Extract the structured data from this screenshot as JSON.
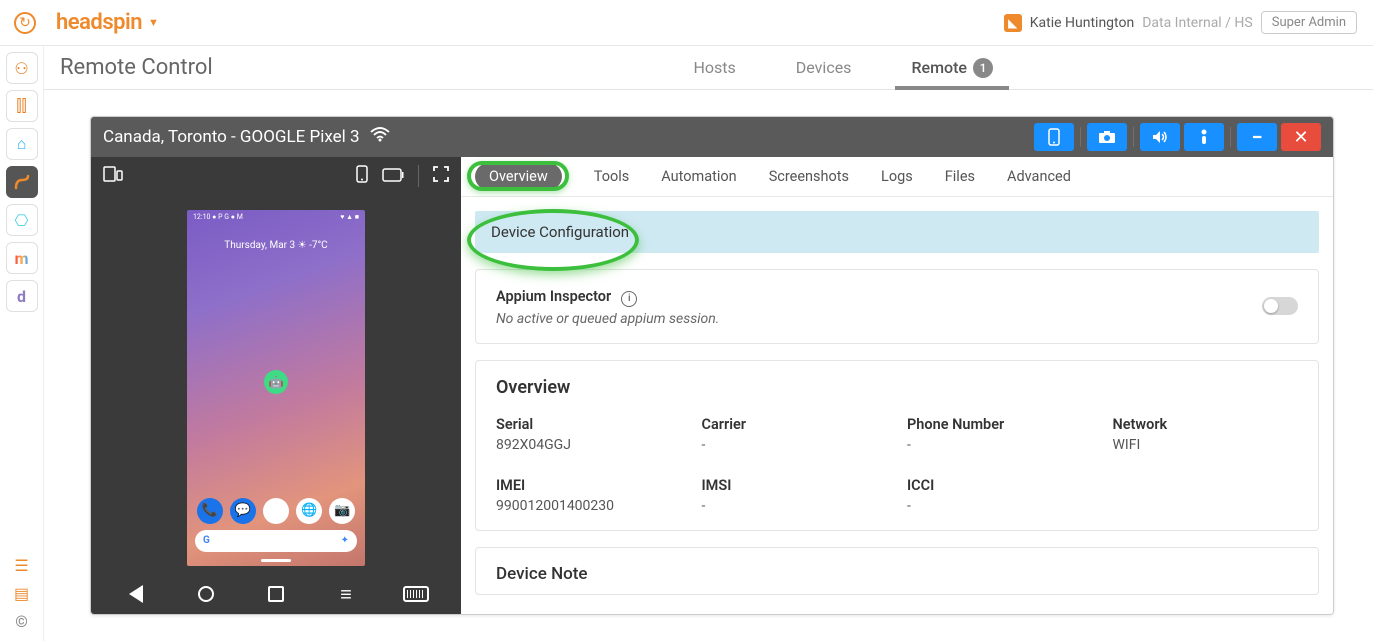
{
  "brand": "headspin",
  "user": {
    "name": "Katie Huntington",
    "org": "Data Internal / HS",
    "role": "Super Admin"
  },
  "page_title": "Remote Control",
  "subtabs": {
    "hosts": "Hosts",
    "devices": "Devices",
    "remote": "Remote",
    "remote_badge": "1"
  },
  "rail_icons": [
    "org",
    "chart",
    "home",
    "route",
    "search",
    "m",
    "d"
  ],
  "device_window": {
    "title": "Canada, Toronto - GOOGLE Pixel 3"
  },
  "phone": {
    "status_left": "12:10 ● P G ● M",
    "status_right": "♥ ▲ ■",
    "date_line": "Thursday, Mar 3 ☀ -7°C",
    "search_letter": "G"
  },
  "tabs": {
    "overview": "Overview",
    "tools": "Tools",
    "automation": "Automation",
    "screenshots": "Screenshots",
    "logs": "Logs",
    "files": "Files",
    "advanced": "Advanced"
  },
  "device_config_label": "Device Configuration",
  "appium": {
    "title": "Appium Inspector",
    "sub": "No active or queued appium session."
  },
  "overview_section": {
    "heading": "Overview",
    "fields": {
      "serial": {
        "label": "Serial",
        "value": "892X04GGJ"
      },
      "carrier": {
        "label": "Carrier",
        "value": "-"
      },
      "phone": {
        "label": "Phone Number",
        "value": "-"
      },
      "network": {
        "label": "Network",
        "value": "WIFI"
      },
      "imei": {
        "label": "IMEI",
        "value": "990012001400230"
      },
      "imsi": {
        "label": "IMSI",
        "value": "-"
      },
      "icci": {
        "label": "ICCI",
        "value": "-"
      }
    }
  },
  "device_note": "Device Note"
}
